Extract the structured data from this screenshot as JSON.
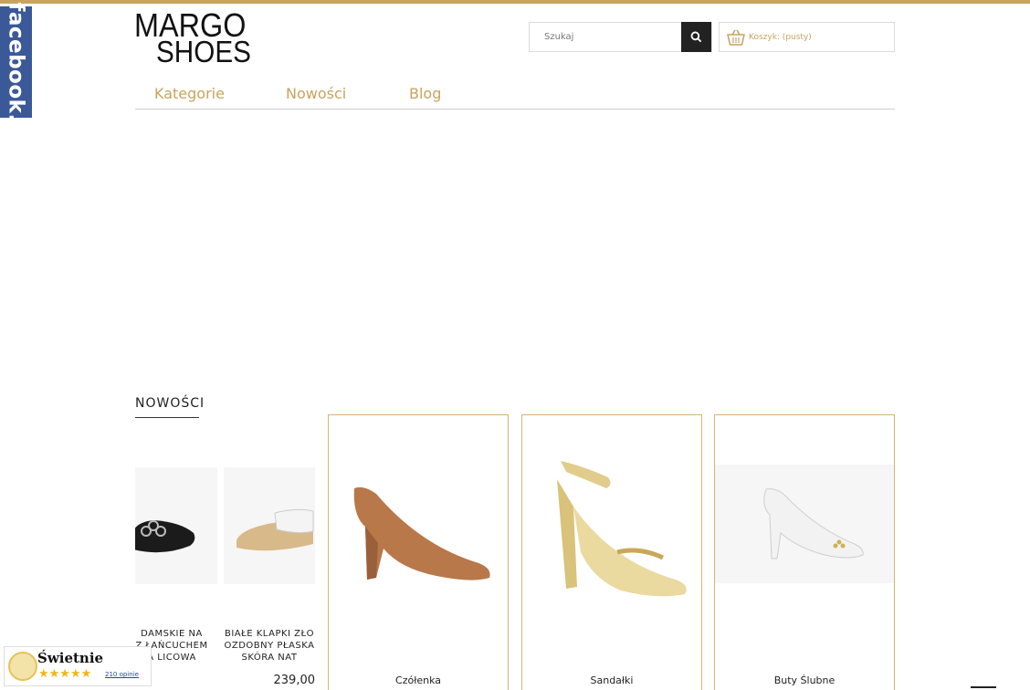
{
  "header": {
    "logo_line1": "MARGO",
    "logo_line2": "SHOES",
    "search_placeholder": "Szukaj",
    "cart_label": "Koszyk: (pusty)"
  },
  "facebook_tab": {
    "label": "facebook."
  },
  "nav": {
    "items": [
      "Kategorie",
      "Nowości",
      "Blog"
    ]
  },
  "new_section": {
    "title": "NOWOŚCI",
    "products": [
      {
        "name": "DAMSKIE NA\nZ ŁAŃCUCHEM\nA LICOWA",
        "price": ""
      },
      {
        "name": "BIAŁE KLAPKI ZŁO\nOZDOBNY PŁASKA\nSKÓRA NAT",
        "price": "239,00"
      }
    ]
  },
  "categories": [
    {
      "name": "Czółenka"
    },
    {
      "name": "Sandałki"
    },
    {
      "name": "Buty Ślubne"
    }
  ],
  "reviews_widget": {
    "title": "Świetnie",
    "stars": "★★★★★",
    "count": "210 opinie"
  },
  "colors": {
    "accent": "#c9a35e",
    "facebook": "#3b5998"
  }
}
